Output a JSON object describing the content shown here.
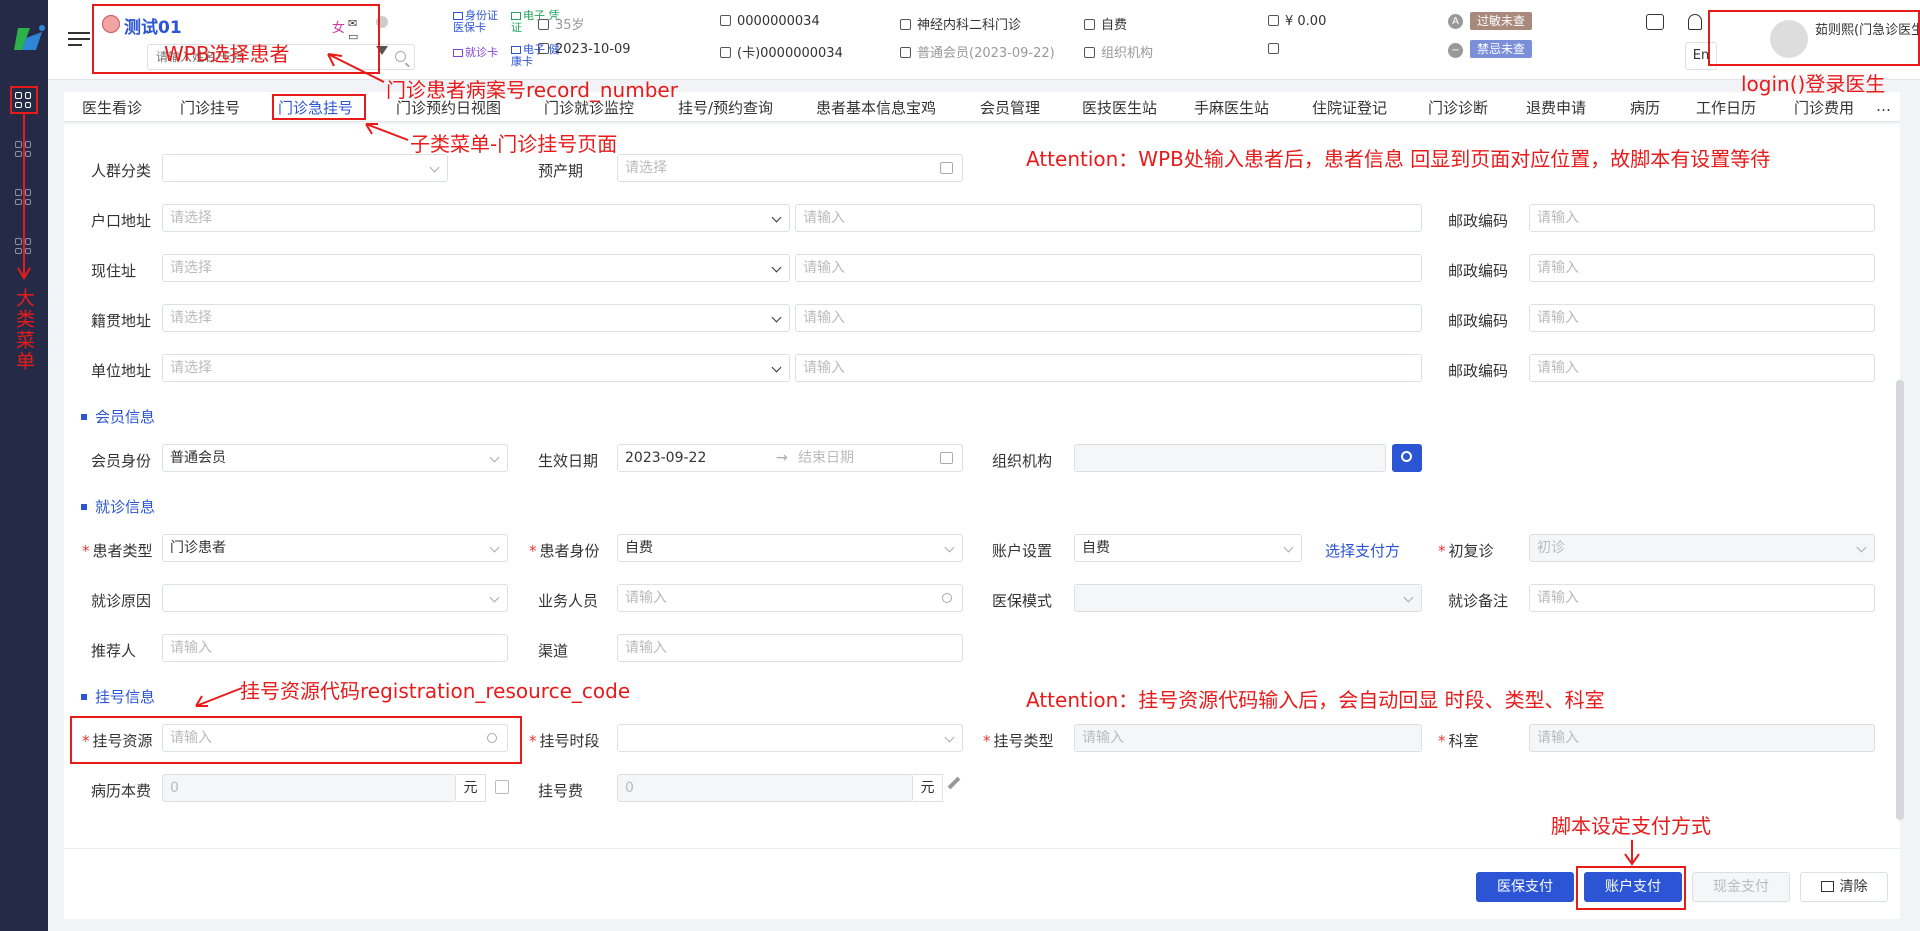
{
  "patient": {
    "name": "测试01",
    "gender": "女",
    "icons_text": "✉ ▭ ⬡",
    "search_placeholder": "请输入姓名/卡号"
  },
  "card_links": [
    {
      "label": "身份证 医保卡"
    },
    {
      "label": "电子 凭证"
    },
    {
      "label": "就诊卡"
    },
    {
      "label": "电子 健康卡"
    }
  ],
  "info": {
    "age": "35岁",
    "date": "2023-10-09",
    "record_no": "0000000034",
    "card_no": "(卡)0000000034",
    "department": "神经内科二科门诊",
    "member": "普通会员(2023-09-22)",
    "fee_type": "自费",
    "org": "组织机构",
    "balance": "¥ 0.00"
  },
  "badges": {
    "allergy_letter": "A",
    "allergy": "过敏未查",
    "taboo": "禁忌未查"
  },
  "lang": "En",
  "doctor": {
    "name": "茹则熙(门急诊医生)"
  },
  "tabs": [
    "医生看诊",
    "门诊挂号",
    "门诊急挂号",
    "门诊预约日视图",
    "门诊就诊监控",
    "挂号/预约查询",
    "患者基本信息宝鸡",
    "会员管理",
    "医技医生站",
    "手麻医生站",
    "住院证登记",
    "门诊诊断",
    "退费申请",
    "病历",
    "工作日历",
    "门诊费用",
    "…"
  ],
  "form": {
    "crowd": "人群分类",
    "due": "预产期",
    "due_ph": "请选择",
    "hukou": "户口地址",
    "current": "现住址",
    "native": "籍贯地址",
    "work": "单位地址",
    "select_ph": "请选择",
    "input_ph": "请输入",
    "postcode": "邮政编码",
    "member_section": "会员信息",
    "member_identity": "会员身份",
    "member_value": "普通会员",
    "effective": "生效日期",
    "effective_start": "2023-09-22",
    "effective_end": "结束日期",
    "org": "组织机构",
    "visit_section": "就诊信息",
    "patient_type": "患者类型",
    "patient_type_value": "门诊患者",
    "patient_identity": "患者身份",
    "patient_identity_value": "自费",
    "account": "账户设置",
    "account_value": "自费",
    "pay_link": "选择支付方",
    "revisit": "初复诊",
    "revisit_value": "初诊",
    "reason": "就诊原因",
    "staff": "业务人员",
    "insurance_mode": "医保模式",
    "visit_note": "就诊备注",
    "referrer": "推荐人",
    "channel": "渠道",
    "reg_section": "挂号信息",
    "reg_resource": "挂号资源",
    "reg_period": "挂号时段",
    "reg_type": "挂号类型",
    "dept": "科室",
    "record_fee": "病历本费",
    "reg_fee": "挂号费",
    "fee_value": "0",
    "unit": "元"
  },
  "buttons": {
    "insurance_pay": "医保支付",
    "account_pay": "账户支付",
    "cash_pay": "现金支付",
    "clear": "清除"
  },
  "annotations": {
    "wpb": "WPB选择患者",
    "record": "门诊患者病案号record_number",
    "login": "login()登录医生",
    "submenu": "子类菜单-门诊挂号页面",
    "attention1": "Attention：WPB处输入患者后，患者信息 回显到页面对应位置，故脚本有设置等待",
    "main_menu": "大类菜单",
    "resource_code": "挂号资源代码registration_resource_code",
    "attention2": "Attention：挂号资源代码输入后，会自动回显 时段、类型、科室",
    "pay_script": "脚本设定支付方式"
  }
}
